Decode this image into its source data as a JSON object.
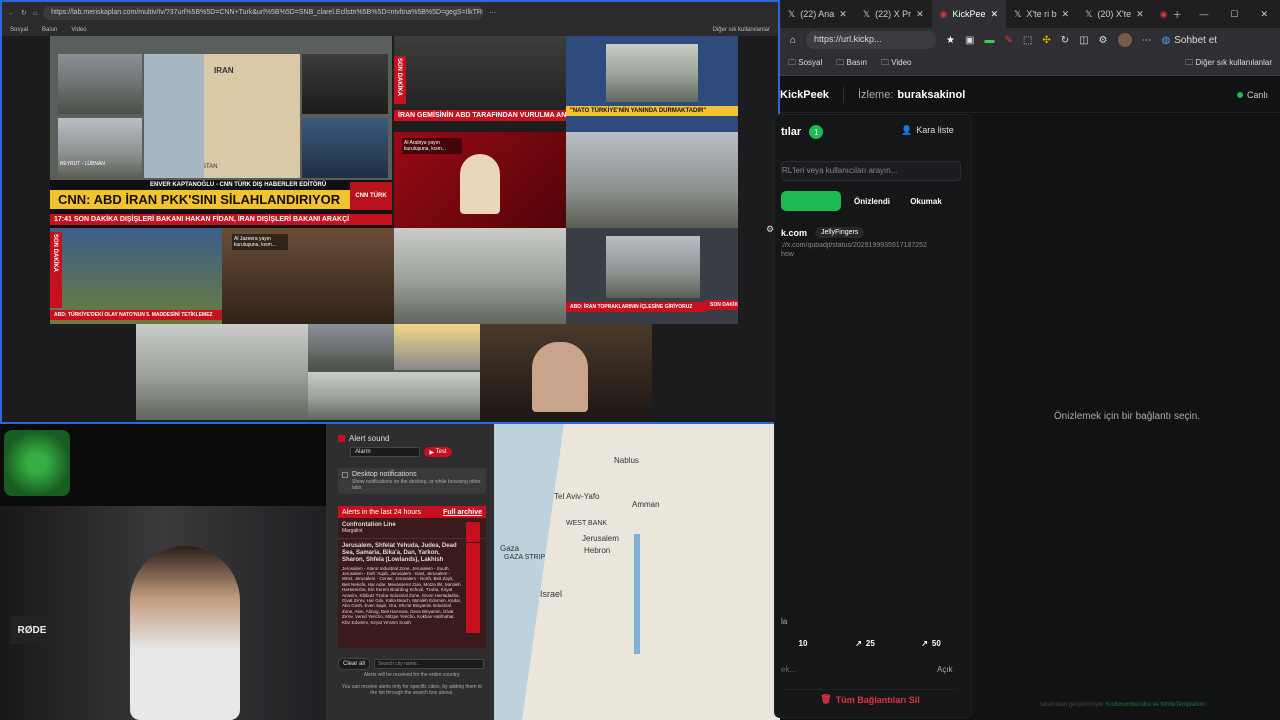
{
  "left_browser": {
    "url": "https://lab.meriskaplan.com/multiv/tv/?37url%5B%5D=CNN+Turk&url%5B%5D=SNB_clarel.Ecllstn%5B%5D=ntvltna%5B%5D=gegS=IlkTR9&5D=Haberturkdzn%...",
    "bookmarks": [
      "Sosyal",
      "Basın",
      "Video"
    ],
    "bookmarks_right": "Diğer sık kullanılanlar"
  },
  "news": {
    "cnn_headline": "CNN: ABD İRAN PKK'SINI SİLAHLANDIRIYOR",
    "cnn_name_tag": "ENVER KAPTANOĞLU - CNN TÜRK DIŞ HABERLER EDİTÖRÜ",
    "cnn_ticker": "DIŞİŞLERİ BAKANI HAKAN FİDAN, İRAN DIŞİŞLERİ BAKANI ARAKÇİ",
    "cnn_logo": "CNN TÜRK",
    "cnn_live": "CANLI",
    "son_dakika": "SON DAKİKA",
    "son_dakika_time": "17:41",
    "tile2_banner": "İRAN GEMİSİNİN ABD TARAFINDAN VURULMA ANI",
    "tile3_banner": "\"NATO TÜRKİYE'NİN YANINDA DURMAKTADIR\"",
    "tile5_banner": "ABD: TÜRKİYE'DEKİ OLAY NATO'NUN 5. MADDESİNİ TETİKLEMEZ",
    "tile6_banner": "ABD: İRAN TOPRAKLARININ İÇLESİNE GİRİYORUZ",
    "tile6_tag": "SON DAKİKA",
    "aljazeera_caption": "Al Arabiya yayın kuruluşuna, kısm...",
    "aljazeera_caption2": "Al Jazeera yayın kuruluşuna, kısm...",
    "map_country": "IRAN",
    "map_country2": "SUUDİ ARABİSTAN",
    "city_label": "BEYRUT - LÜBNAN"
  },
  "alert_panel": {
    "alert_sound_label": "Alert sound",
    "alert_select": "Alarm",
    "test_button": "Test",
    "desktop_notif_label": "Desktop notifications",
    "desktop_notif_desc": "Show notifications on the desktop, or while browsing other tabs",
    "alerts_header": "Alerts in the last 24 hours",
    "full_archive": "Full archive",
    "alert1_title": "Confrontation Line",
    "alert1_sub": "Margaliot",
    "alert2_title": "Jerusalem, Shfelat Yehuda, Judea, Dead Sea, Samaria, Bika'a, Dan, Yarkon, Sharon, Shfela (Lowlands), Lakhish",
    "alert2_body": "Jerusalem - Atarot Industrial Zone, Jerusalem - South, Jerusalem - Dafr 'Aqab, Jerusalem - East, Jerusalem - West, Jerusalem - Center, Jerusalem - North, Beit Zayit, Beit Nekofa, Har Adar, Mevasseret Zion, Motza Illit, Ma'aleh HaHamisha, Ein Kerem Boarding School, Tzuba, Kiryat Anavim, Kibbutz Tzuba Industrial Zone, Givon HaHadasha, Givat Ze'ev, Har Gilo, Kalia Beach, Ma'aleh Edomim, Kedar, Abu Gosh, Even Sapir, Ora, Sho'ar Binyamin Industrial Zone, Alon, Almog, Beit HaArava, Geva Binyamin, Givat Ze'ev, Vered Yericho, Mitzpe Yericho, Kokhav HaShahar, Kfar Edomim, Kiryat Ye'arim South",
    "clear_all": "Clear all",
    "search_placeholder": "Search city name...",
    "alerts_note": "Alerts will be received for the entire country.",
    "alerts_help": "You can receive alerts only for specific cities, by adding them to the list through the search box above."
  },
  "map": {
    "labels": [
      "Tel Aviv-Yafo",
      "WEST BANK",
      "Amman",
      "Jerusalem",
      "Hebron",
      "Gaza",
      "GAZA STRIP",
      "Israel",
      "Nablus"
    ]
  },
  "right_browser": {
    "tabs": [
      "(22) Ana",
      "(22) X Pr",
      "KickPee",
      "X'te ri b",
      "(20) X'te"
    ],
    "url": "https://url.kickp...",
    "profile_label": "Sohbet et",
    "bookmarks": [
      "Sosyal",
      "Basın",
      "Video"
    ],
    "bookmarks_right": "Diğer sık kullanılanlar"
  },
  "kickpeek": {
    "app_name": "KickPeek",
    "watching_label": "İzleme:",
    "watching_user": "buraksakinol",
    "live_status": "Canlı",
    "links_title": "tılar",
    "links_count": "1",
    "blacklist": "Kara liste",
    "search_placeholder": "RL'leri veya kullanıcıları arayın...",
    "tabs": [
      "Okunmamış",
      "Önizlendi",
      "Okumak"
    ],
    "link_domain": "k.com",
    "link_user": "JellyFingers",
    "link_url": "://x.com/qubadjt/status/2029199935917187252",
    "link_show": "how",
    "preview_empty": "Önizlemek için bir bağlantı seçin.",
    "partial_label": "la",
    "page_sizes": [
      "10",
      "25",
      "50"
    ],
    "input_placeholder": "ek...",
    "input_state": "Açık",
    "delete_all": "Tüm Bağlantıları Sil",
    "footer_text": "tarafından geliştirilmiştir.",
    "footer_credit": "Kodunumbendisi ve WhiteTemplation"
  },
  "colors": {
    "accent_green": "#1db954",
    "kick_green": "#53fc18",
    "danger_red": "#e0343f",
    "alert_red": "#c7101d"
  }
}
